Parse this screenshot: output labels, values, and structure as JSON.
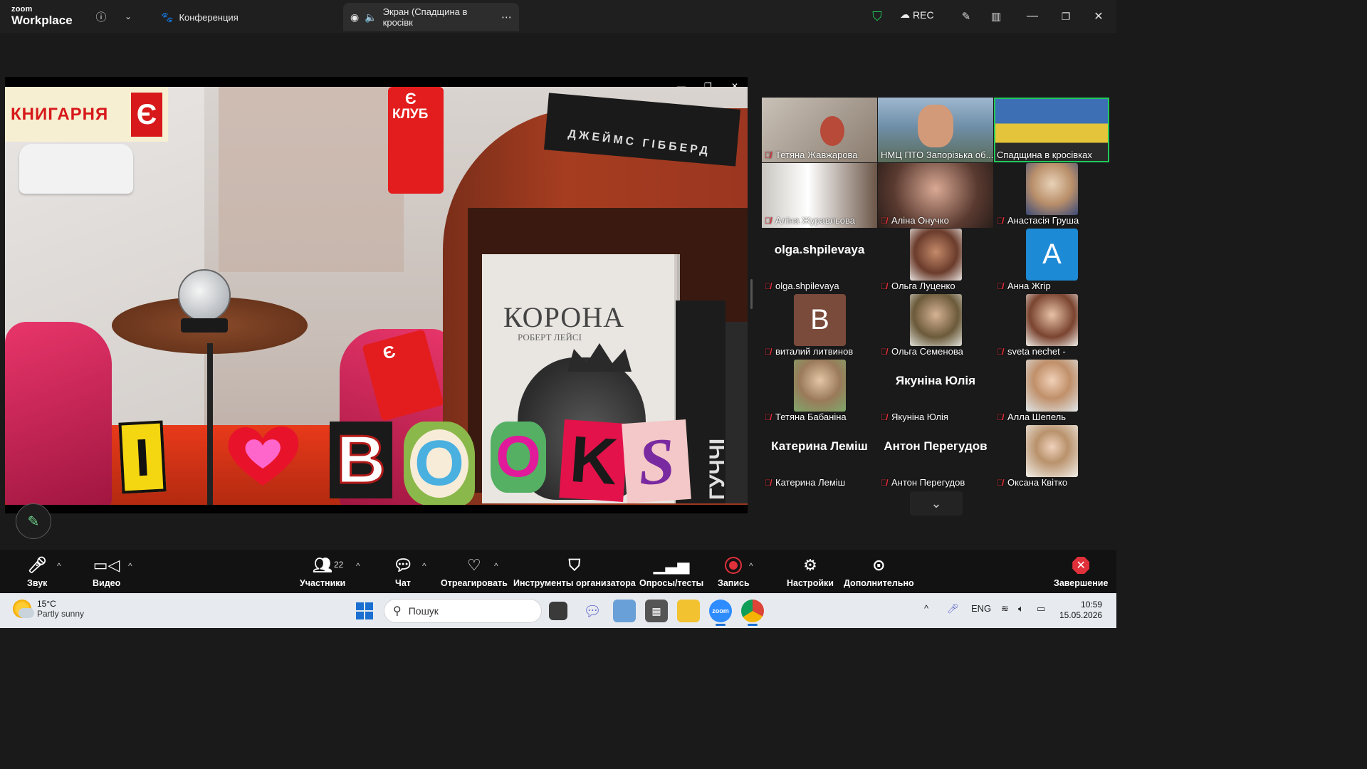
{
  "app": {
    "logo_line1": "zoom",
    "logo_line2": "Workplace"
  },
  "titlebar": {
    "tabs": [
      {
        "label": "Конференция",
        "icon": "paw-icon"
      },
      {
        "label": "Экран (Спадщина в кросівк",
        "icon": "speaker-icon"
      }
    ],
    "rec_label": "REC",
    "colors": {
      "shield": "#21c95b",
      "rec": "#ffffff"
    }
  },
  "share": {
    "shop_sign": "КНИГАРНЯ",
    "shop_mark": "Є",
    "club_label": "КЛУБ",
    "club_mark": "Є",
    "book_top_title": "ДЖЕЙМС ГІББЕРД",
    "book_title": "КОРОНА",
    "book_author": "РОБЕРТ ЛЕЙСІ",
    "book_spine": "ГУЧЧІ",
    "collage_letters": [
      "I",
      "B",
      "O",
      "O",
      "K",
      "S"
    ]
  },
  "gallery": {
    "participants": [
      {
        "name": "Тетяна Жавжарова",
        "type": "video",
        "muted": true
      },
      {
        "name": "НМЦ ПТО Запорізька об...",
        "type": "video",
        "muted": false
      },
      {
        "name": "Спадщина в кросівках",
        "type": "video",
        "muted": false,
        "active": true
      },
      {
        "name": "Аліна Журавльова",
        "type": "video",
        "muted": true
      },
      {
        "name": "Аліна Онучко",
        "type": "video",
        "muted": true
      },
      {
        "name": "Анастасія Груша",
        "type": "avatar",
        "muted": true
      },
      {
        "name": "olga.shpilevaya",
        "type": "name",
        "big_name": "olga.shpilevaya",
        "muted": true
      },
      {
        "name": "Ольга Луценко",
        "type": "avatar",
        "muted": true
      },
      {
        "name": "Анна Жгір",
        "type": "letter",
        "letter": "A",
        "color": "#1d8ad6",
        "muted": true
      },
      {
        "name": "виталий литвинов",
        "type": "letter",
        "letter": "B",
        "color": "#7a4a3a",
        "muted": true
      },
      {
        "name": "Ольга Семенова",
        "type": "avatar",
        "muted": true
      },
      {
        "name": "sveta nechet -",
        "type": "avatar",
        "muted": true
      },
      {
        "name": "Тетяна Бабаніна",
        "type": "avatar",
        "muted": true
      },
      {
        "name": "Якуніна Юлія",
        "type": "name",
        "big_name": "Якуніна Юлія",
        "muted": true
      },
      {
        "name": "Алла Шепель",
        "type": "avatar",
        "muted": true
      },
      {
        "name": "Катерина Леміш",
        "type": "name",
        "big_name": "Катерина Леміш",
        "muted": true
      },
      {
        "name": "Антон Перегудов",
        "type": "name",
        "big_name": "Антон Перегудов",
        "muted": true
      },
      {
        "name": "Оксана Квітко",
        "type": "avatar",
        "muted": true
      }
    ]
  },
  "toolbar": {
    "audio": "Звук",
    "video": "Видео",
    "participants": "Участники",
    "participants_count": "22",
    "chat": "Чат",
    "react": "Отреагировать",
    "host_tools": "Инструменты организатора",
    "polls": "Опросы/тесты",
    "record": "Запись",
    "settings": "Настройки",
    "more": "Дополнительно",
    "end": "Завершение"
  },
  "taskbar": {
    "weather_temp": "15°C",
    "weather_desc": "Partly sunny",
    "search_placeholder": "Пошук",
    "lang": "ENG",
    "time": "10:59",
    "date": "15.05.2026"
  }
}
